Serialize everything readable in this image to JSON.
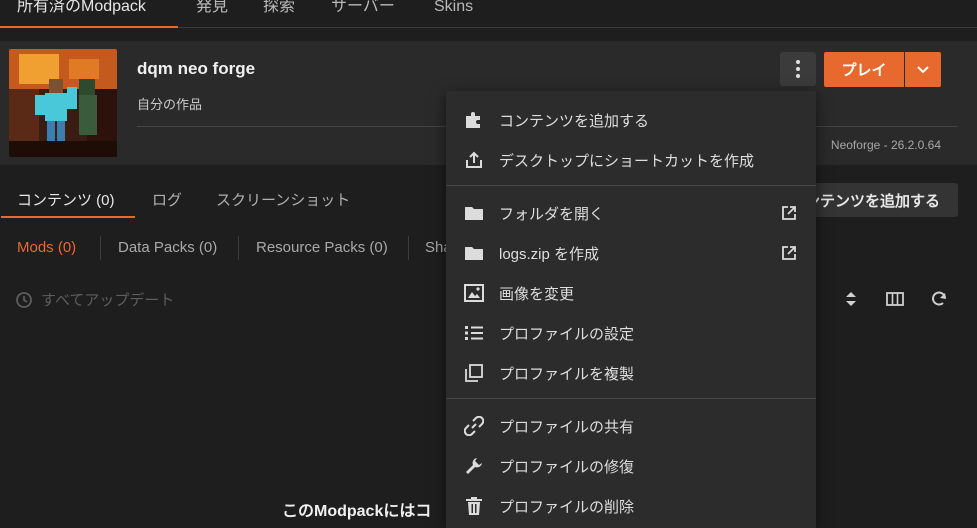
{
  "top_nav": {
    "tabs": [
      "所有済のModpack",
      "発見",
      "探索",
      "サーバー",
      "Skins"
    ],
    "accent_color": "#e8692d"
  },
  "profile": {
    "title": "dqm neo forge",
    "subtitle": "自分の作品",
    "version": "Neoforge - 26.2.0.64",
    "play_label": "プレイ"
  },
  "content_tabs": {
    "tabs": [
      "コンテンツ (0)",
      "ログ",
      "スクリーンショット"
    ],
    "add_content_label": "コンテンツを追加する"
  },
  "sub_tabs": [
    "Mods (0)",
    "Data Packs (0)",
    "Resource Packs (0)",
    "Sha"
  ],
  "toolbar": {
    "update_all_label": "すべてアップデート",
    "icons": [
      "sort-icon",
      "columns-icon",
      "refresh-icon"
    ]
  },
  "empty_message": "このModpackにはコ",
  "menu": {
    "items": [
      {
        "label": "コンテンツを追加する",
        "icon": "puzzle-icon"
      },
      {
        "label": "デスクトップにショートカットを作成",
        "icon": "share-icon"
      },
      {
        "label": "フォルダを開く",
        "icon": "folder-icon",
        "external": true
      },
      {
        "label": "logs.zip を作成",
        "icon": "folder-icon",
        "external": true
      },
      {
        "label": "画像を変更",
        "icon": "image-icon"
      },
      {
        "label": "プロファイルの設定",
        "icon": "list-icon"
      },
      {
        "label": "プロファイルを複製",
        "icon": "copy-icon"
      },
      {
        "label": "プロファイルの共有",
        "icon": "link-icon"
      },
      {
        "label": "プロファイルの修復",
        "icon": "wrench-icon"
      },
      {
        "label": "プロファイルの削除",
        "icon": "trash-icon"
      }
    ]
  }
}
